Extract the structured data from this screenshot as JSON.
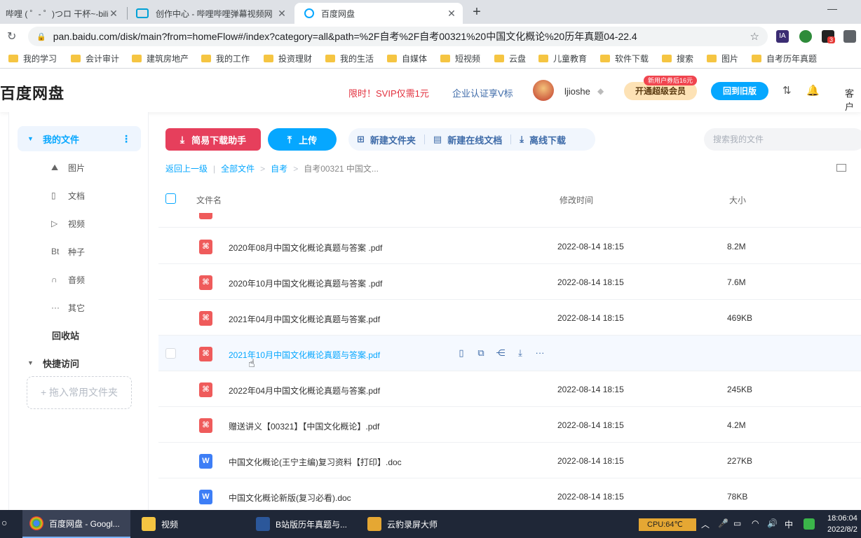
{
  "browser": {
    "tabs": [
      {
        "title": "哔哩 ( ゜- ゜)つロ 干杯~-bilil",
        "close": "✕"
      },
      {
        "title": "创作中心 - 哔哩哔哩弹幕视频网",
        "close": "✕"
      },
      {
        "title": "百度网盘",
        "close": "✕"
      }
    ],
    "new_tab": "+",
    "window_min": "—",
    "url": "pan.baidu.com/disk/main?from=homeFlow#/index?category=all&path=%2F自考%2F自考00321%20中国文化概论%20历年真题04-22.4",
    "ext_badge": "3",
    "bookmarks": [
      "我的学习",
      "会计审计",
      "建筑房地产",
      "我的工作",
      "投资理财",
      "我的生活",
      "自媒体",
      "短视频",
      "云盘",
      "儿童教育",
      "软件下载",
      "搜索",
      "图片",
      "自考历年真题"
    ]
  },
  "header": {
    "logo": "百度网盘",
    "promo": "限时！SVIP仅需1元",
    "enterprise": "企业认证享V标",
    "username": "ljioshe",
    "open_vip": "开通超级会员",
    "vip_badge": "新用户券后16元",
    "old_version": "回到旧版",
    "client": "客户"
  },
  "sidebar": {
    "my_files": "我的文件",
    "sub_items": [
      {
        "icon": "image-icon",
        "label": "图片"
      },
      {
        "icon": "document-icon",
        "label": "文档"
      },
      {
        "icon": "video-icon",
        "label": "视频"
      },
      {
        "icon": "torrent-icon",
        "label": "种子"
      },
      {
        "icon": "audio-icon",
        "label": "音频"
      },
      {
        "icon": "more-icon",
        "label": "其它"
      }
    ],
    "recycle": "回收站",
    "quick_access": "快捷访问",
    "drop_hint": "+ 拖入常用文件夹"
  },
  "toolbar": {
    "download_helper": "简易下载助手",
    "upload": "上传",
    "new_folder": "新建文件夹",
    "new_online_doc": "新建在线文档",
    "offline_download": "离线下载",
    "search_placeholder": "搜索我的文件"
  },
  "breadcrumb": {
    "back": "返回上一级",
    "all_files": "全部文件",
    "level1": "自考",
    "current": "自考00321 中国文..."
  },
  "columns": {
    "name": "文件名",
    "modified": "修改时间",
    "size": "大小"
  },
  "files": [
    {
      "name": "2020年08月中国文化概论真题与答案 .pdf",
      "time": "2022-08-14 18:15",
      "size": "8.2M",
      "type": "pdf"
    },
    {
      "name": "2020年10月中国文化概论真题与答案 .pdf",
      "time": "2022-08-14 18:15",
      "size": "7.6M",
      "type": "pdf"
    },
    {
      "name": "2021年04月中国文化概论真题与答案.pdf",
      "time": "2022-08-14 18:15",
      "size": "469KB",
      "type": "pdf"
    },
    {
      "name": "2021年10月中国文化概论真题与答案.pdf",
      "time": "",
      "size": "",
      "type": "pdf"
    },
    {
      "name": "2022年04月中国文化概论真题与答案.pdf",
      "time": "2022-08-14 18:15",
      "size": "245KB",
      "type": "pdf"
    },
    {
      "name": "赠送讲义【00321】【中国文化概论】.pdf",
      "time": "2022-08-14 18:15",
      "size": "4.2M",
      "type": "pdf"
    },
    {
      "name": "中国文化概论(王宁主编)复习资料【打印】.doc",
      "time": "2022-08-14 18:15",
      "size": "227KB",
      "type": "doc"
    },
    {
      "name": "中国文化概论新版(复习必看).doc",
      "time": "2022-08-14 18:15",
      "size": "78KB",
      "type": "doc"
    }
  ],
  "taskbar": {
    "items": [
      "百度网盘 - Googl...",
      "视频",
      "B站版历年真题与...",
      "云豹录屏大师"
    ],
    "cpu": "CPU:64℃",
    "ime": "中",
    "time": "18:06:04",
    "date": "2022/8/2"
  }
}
